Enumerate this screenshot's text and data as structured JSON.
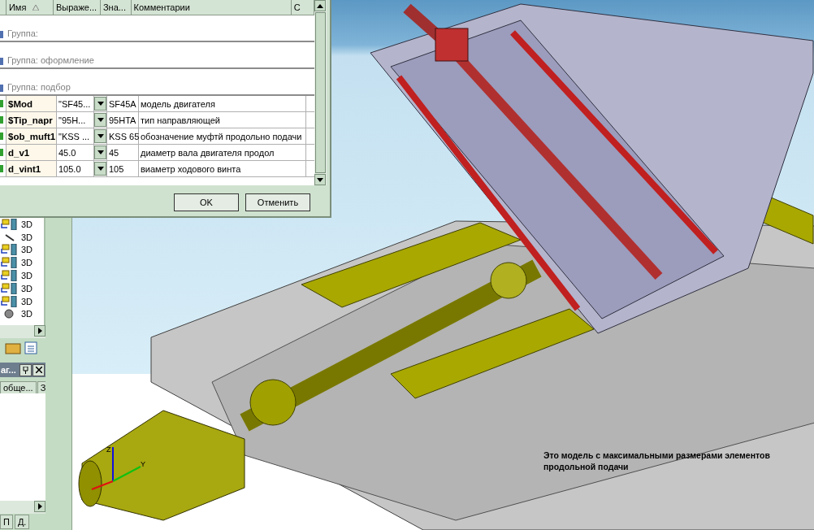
{
  "dialog": {
    "columns": [
      "Имя",
      "Выраже...",
      "Зна...",
      "Комментарии",
      "С"
    ],
    "groups": [
      "Группа:",
      "Группа: оформление",
      "Группа: подбор"
    ],
    "rows": [
      {
        "name": "$Mod",
        "expression": "\"SF45...",
        "value": "SF45A",
        "comment": "модель двигателя"
      },
      {
        "name": "$Tip_napr",
        "expression": "\"95H...",
        "value": "95HTA",
        "comment": "тип направляющей"
      },
      {
        "name": "$ob_muft1",
        "expression": "\"KSS ...",
        "value": "KSS 65",
        "comment": "обозначение муфтй продольно подачи"
      },
      {
        "name": "d_v1",
        "expression": "45.0",
        "value": "45",
        "comment": "диаметр вала двигателя продол"
      },
      {
        "name": "d_vint1",
        "expression": "105.0",
        "value": "105",
        "comment": "виаметр ходового винта"
      }
    ],
    "buttons": [
      "OK",
      "Отменить"
    ]
  },
  "tree": {
    "items": [
      {
        "label": "3D",
        "kind": "assembly"
      },
      {
        "label": "3D",
        "kind": "sketch"
      },
      {
        "label": "3D",
        "kind": "assembly"
      },
      {
        "label": "3D",
        "kind": "assembly"
      },
      {
        "label": "3D",
        "kind": "assembly"
      },
      {
        "label": "3D",
        "kind": "assembly"
      },
      {
        "label": "3D",
        "kind": "assembly"
      },
      {
        "label": "3D",
        "kind": "component"
      }
    ]
  },
  "panel": {
    "title": "аг...",
    "tabs": [
      "обще...",
      "З"
    ]
  },
  "bottom_tabs": [
    "П",
    "Д."
  ],
  "viewport": {
    "axes": [
      "Z",
      "Y"
    ],
    "note": "Это модель с максимальными размерами элементов продольной подачи"
  }
}
